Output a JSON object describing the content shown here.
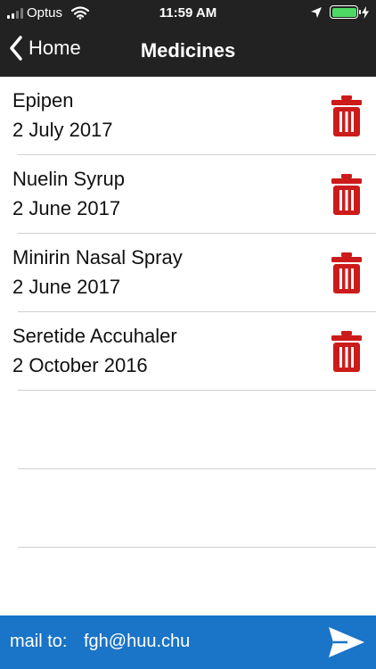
{
  "status_bar": {
    "carrier": "Optus",
    "time": "11:59 AM",
    "battery_color": "#4cd964"
  },
  "nav": {
    "back_label": "Home",
    "title": "Medicines"
  },
  "medicines": [
    {
      "name": "Epipen",
      "date": "2 July 2017"
    },
    {
      "name": "Nuelin Syrup",
      "date": "2 June 2017"
    },
    {
      "name": "Minirin Nasal Spray",
      "date": "2 June 2017"
    },
    {
      "name": "Seretide Accuhaler",
      "date": "2 October 2016"
    }
  ],
  "footer": {
    "mail_label": "mail to:",
    "email": "fgh@huu.chu"
  },
  "colors": {
    "header_bg": "#222222",
    "trash": "#cc1b1b",
    "footer_bg": "#1a74c7"
  }
}
